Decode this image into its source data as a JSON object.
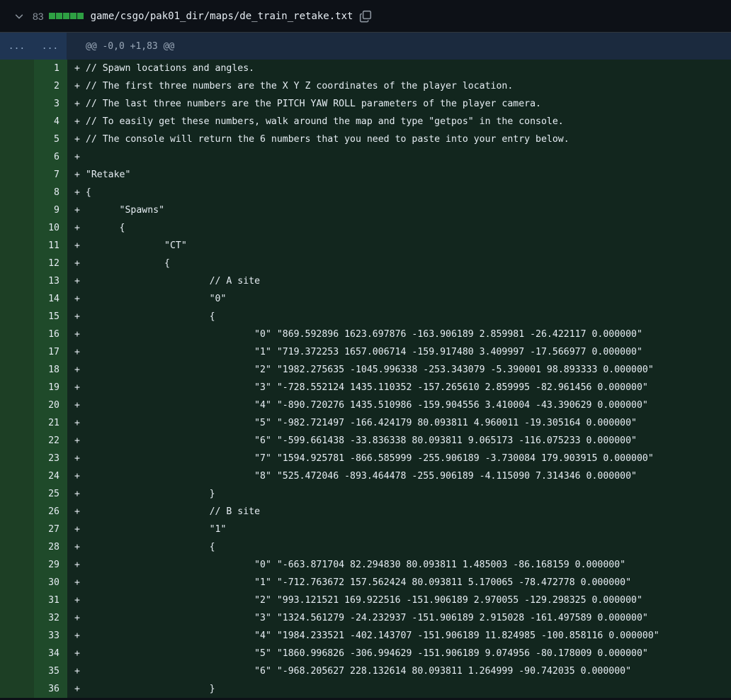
{
  "file": {
    "change_count": "83",
    "path": "game/csgo/pak01_dir/maps/de_train_retake.txt",
    "diffstat_blocks": 5,
    "add_color": "#2ea043"
  },
  "hunk": {
    "old_gutter": "...",
    "new_gutter": "...",
    "header": "@@ -0,0 +1,83 @@"
  },
  "lines": [
    {
      "n": "1",
      "text": "// Spawn locations and angles."
    },
    {
      "n": "2",
      "text": "// The first three numbers are the X Y Z coordinates of the player location."
    },
    {
      "n": "3",
      "text": "// The last three numbers are the PITCH YAW ROLL parameters of the player camera."
    },
    {
      "n": "4",
      "text": "// To easily get these numbers, walk around the map and type \"getpos\" in the console."
    },
    {
      "n": "5",
      "text": "// The console will return the 6 numbers that you need to paste into your entry below."
    },
    {
      "n": "6",
      "text": ""
    },
    {
      "n": "7",
      "text": "\"Retake\""
    },
    {
      "n": "8",
      "text": "{"
    },
    {
      "n": "9",
      "text": "\t\"Spawns\""
    },
    {
      "n": "10",
      "text": "\t{"
    },
    {
      "n": "11",
      "text": "\t\t\"CT\""
    },
    {
      "n": "12",
      "text": "\t\t{"
    },
    {
      "n": "13",
      "text": "\t\t\t// A site"
    },
    {
      "n": "14",
      "text": "\t\t\t\"0\""
    },
    {
      "n": "15",
      "text": "\t\t\t{"
    },
    {
      "n": "16",
      "text": "\t\t\t\t\"0\" \"869.592896 1623.697876 -163.906189 2.859981 -26.422117 0.000000\""
    },
    {
      "n": "17",
      "text": "\t\t\t\t\"1\" \"719.372253 1657.006714 -159.917480 3.409997 -17.566977 0.000000\""
    },
    {
      "n": "18",
      "text": "\t\t\t\t\"2\" \"1982.275635 -1045.996338 -253.343079 -5.390001 98.893333 0.000000\""
    },
    {
      "n": "19",
      "text": "\t\t\t\t\"3\" \"-728.552124 1435.110352 -157.265610 2.859995 -82.961456 0.000000\""
    },
    {
      "n": "20",
      "text": "\t\t\t\t\"4\" \"-890.720276 1435.510986 -159.904556 3.410004 -43.390629 0.000000\""
    },
    {
      "n": "21",
      "text": "\t\t\t\t\"5\" \"-982.721497 -166.424179 80.093811 4.960011 -19.305164 0.000000\""
    },
    {
      "n": "22",
      "text": "\t\t\t\t\"6\" \"-599.661438 -33.836338 80.093811 9.065173 -116.075233 0.000000\""
    },
    {
      "n": "23",
      "text": "\t\t\t\t\"7\" \"1594.925781 -866.585999 -255.906189 -3.730084 179.903915 0.000000\""
    },
    {
      "n": "24",
      "text": "\t\t\t\t\"8\" \"525.472046 -893.464478 -255.906189 -4.115090 7.314346 0.000000\""
    },
    {
      "n": "25",
      "text": "\t\t\t}"
    },
    {
      "n": "26",
      "text": "\t\t\t// B site"
    },
    {
      "n": "27",
      "text": "\t\t\t\"1\""
    },
    {
      "n": "28",
      "text": "\t\t\t{"
    },
    {
      "n": "29",
      "text": "\t\t\t\t\"0\" \"-663.871704 82.294830 80.093811 1.485003 -86.168159 0.000000\""
    },
    {
      "n": "30",
      "text": "\t\t\t\t\"1\" \"-712.763672 157.562424 80.093811 5.170065 -78.472778 0.000000\""
    },
    {
      "n": "31",
      "text": "\t\t\t\t\"2\" \"993.121521 169.922516 -151.906189 2.970055 -129.298325 0.000000\""
    },
    {
      "n": "32",
      "text": "\t\t\t\t\"3\" \"1324.561279 -24.232937 -151.906189 2.915028 -161.497589 0.000000\""
    },
    {
      "n": "33",
      "text": "\t\t\t\t\"4\" \"1984.233521 -402.143707 -151.906189 11.824985 -100.858116 0.000000\""
    },
    {
      "n": "34",
      "text": "\t\t\t\t\"5\" \"1860.996826 -306.994629 -151.906189 9.074956 -80.178009 0.000000\""
    },
    {
      "n": "35",
      "text": "\t\t\t\t\"6\" \"-968.205627 228.132614 80.093811 1.264999 -90.742035 0.000000\""
    },
    {
      "n": "36",
      "text": "\t\t\t}"
    }
  ]
}
